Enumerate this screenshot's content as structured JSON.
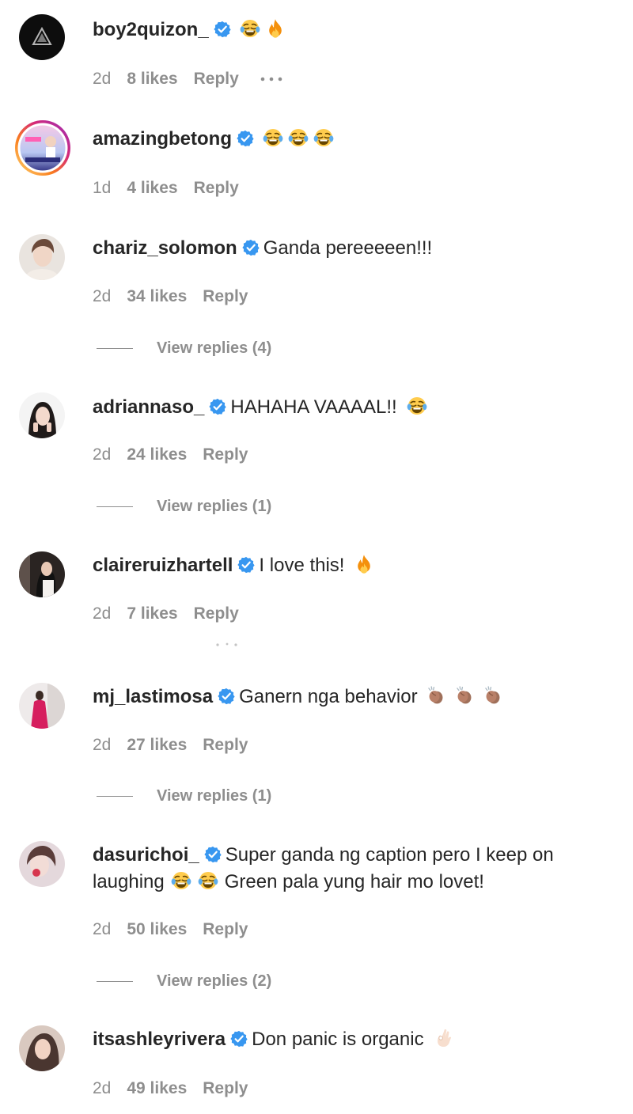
{
  "colors": {
    "verified_badge": "#3897f0",
    "meta_text": "#8e8e8e",
    "text": "#262626"
  },
  "comments": [
    {
      "username": "boy2quizon_",
      "text": "",
      "emojis": [
        "laughing-crying-emoji",
        "fire-emoji"
      ],
      "time": "2d",
      "likes": "8 likes",
      "reply": "Reply",
      "has_more": true
    },
    {
      "username": "amazingbetong",
      "text": "",
      "emojis": [
        "laughing-crying-emoji",
        "laughing-crying-emoji",
        "laughing-crying-emoji"
      ],
      "time": "1d",
      "likes": "4 likes",
      "reply": "Reply"
    },
    {
      "username": "chariz_solomon",
      "text": "Ganda pereeeeen!!!",
      "time": "2d",
      "likes": "34 likes",
      "reply": "Reply",
      "view_replies": "View replies (4)"
    },
    {
      "username": "adriannaso_",
      "text": "HAHAHA VAAAAL!!",
      "emojis": [
        "laughing-crying-emoji"
      ],
      "time": "2d",
      "likes": "24 likes",
      "reply": "Reply",
      "view_replies": "View replies (1)"
    },
    {
      "username": "claireruizhartell",
      "text": "I love this!",
      "emojis": [
        "fire-emoji"
      ],
      "time": "2d",
      "likes": "7 likes",
      "reply": "Reply"
    },
    {
      "username": "mj_lastimosa",
      "text": "Ganern nga behavior",
      "emojis": [
        "clapping-hands-emoji",
        "clapping-hands-emoji",
        "clapping-hands-emoji"
      ],
      "time": "2d",
      "likes": "27 likes",
      "reply": "Reply",
      "view_replies": "View replies (1)"
    },
    {
      "username": "dasurichoi_",
      "text_part1": "Super ganda ng caption pero I keep on laughing",
      "text_part2": "Green pala yung hair mo lovet!",
      "emojis": [
        "laughing-crying-emoji",
        "laughing-crying-emoji"
      ],
      "time": "2d",
      "likes": "50 likes",
      "reply": "Reply",
      "view_replies": "View replies (2)"
    },
    {
      "username": "itsashleyrivera",
      "text": "Don panic is organic",
      "emojis": [
        "ok-hand-emoji"
      ],
      "time": "2d",
      "likes": "49 likes",
      "reply": "Reply"
    }
  ]
}
